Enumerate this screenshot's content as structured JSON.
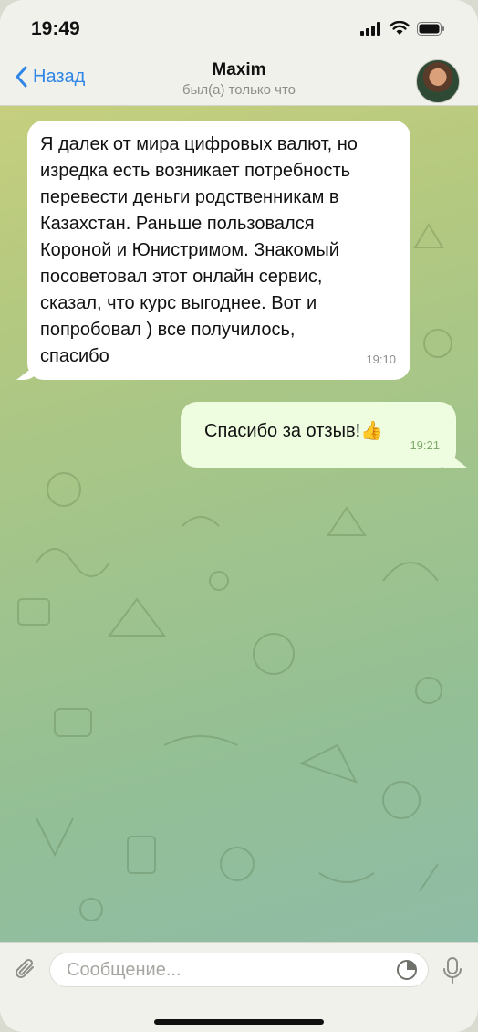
{
  "status_bar": {
    "time": "19:49"
  },
  "header": {
    "back_label": "Назад",
    "contact_name": "Maxim",
    "last_seen": "был(а) только что"
  },
  "messages": [
    {
      "direction": "incoming",
      "lines": [
        "Я далек от мира цифровых валют, но",
        "изредка есть возникает потребность",
        "перевести деньги родственникам в",
        "Казахстан. Раньше пользовался",
        "Короной и Юнистримом. Знакомый",
        "посоветовал этот онлайн сервис,",
        "сказал, что курс выгоднее. Вот и",
        "попробовал ) все получилось,",
        "спасибо"
      ],
      "time": "19:10"
    },
    {
      "direction": "outgoing",
      "text": "Спасибо за отзыв!👍",
      "time": "19:21"
    }
  ],
  "composer": {
    "placeholder": "Сообщение..."
  },
  "colors": {
    "accent": "#2f86e6",
    "outgoing_bubble": "#eefce0",
    "incoming_bubble": "#ffffff"
  },
  "icons": [
    "back-chevron-icon",
    "signal-icon",
    "wifi-icon",
    "battery-icon",
    "paperclip-icon",
    "sticker-icon",
    "microphone-icon"
  ]
}
